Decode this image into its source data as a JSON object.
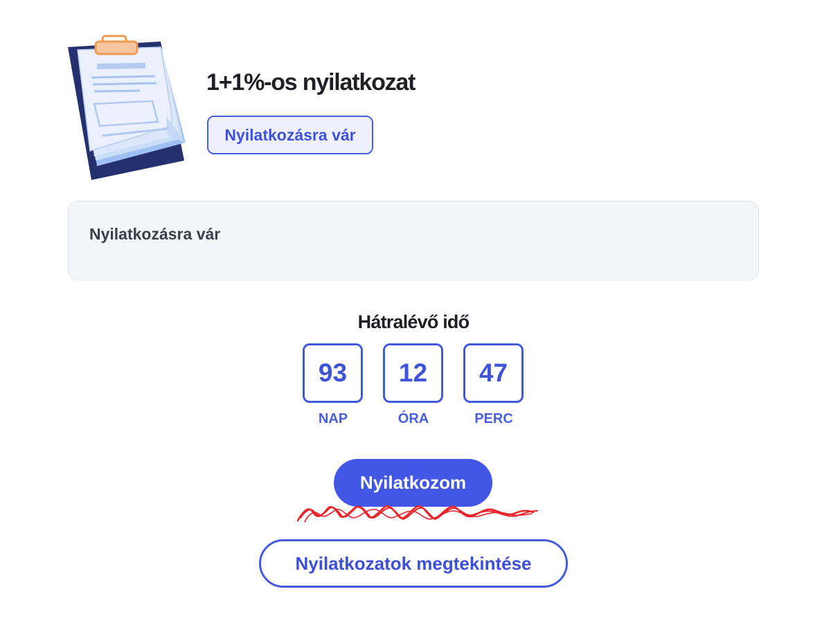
{
  "header": {
    "title": "1+1%-os nyilatkozat",
    "status_badge": "Nyilatkozásra vár",
    "illustration_icon": "clipboard-document-icon"
  },
  "info_panel": {
    "text": "Nyilatkozásra vár"
  },
  "countdown": {
    "title": "Hátralévő idő",
    "days": "93",
    "days_label": "NAP",
    "hours": "12",
    "hours_label": "ÓRA",
    "minutes": "47",
    "minutes_label": "PERC"
  },
  "actions": {
    "primary_label": "Nyilatkozom",
    "secondary_label": "Nyilatkozatok megtekintése"
  },
  "colors": {
    "accent": "#4257e3",
    "scribble": "#e8242b",
    "panel_background": "#f4f5f9"
  }
}
